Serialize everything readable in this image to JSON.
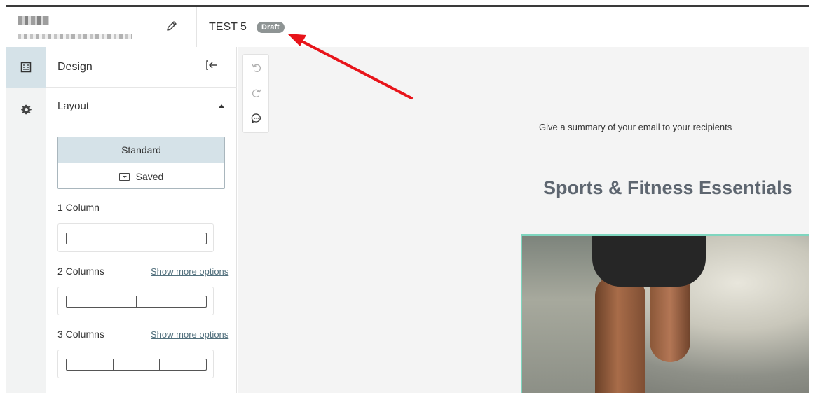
{
  "header": {
    "title": "TEST 5",
    "status_badge": "Draft"
  },
  "rail": {
    "items": [
      {
        "icon": "layout-icon",
        "active": true
      },
      {
        "icon": "gear-icon",
        "active": false
      }
    ]
  },
  "panel": {
    "title": "Design",
    "section": "Layout",
    "segments": {
      "standard": "Standard",
      "saved": "Saved"
    },
    "groups": [
      {
        "label": "1 Column",
        "link": ""
      },
      {
        "label": "2 Columns",
        "link": "Show more options"
      },
      {
        "label": "3 Columns",
        "link": "Show more options"
      }
    ]
  },
  "canvas": {
    "preheader": "Give a summary of your email to your recipients",
    "headline": "Sports & Fitness Essentials"
  },
  "colors": {
    "accent_border": "#7fd6bf",
    "badge_bg": "#8e9494",
    "annotation_arrow": "#e8141a",
    "active_bg": "#d5e2e8"
  }
}
